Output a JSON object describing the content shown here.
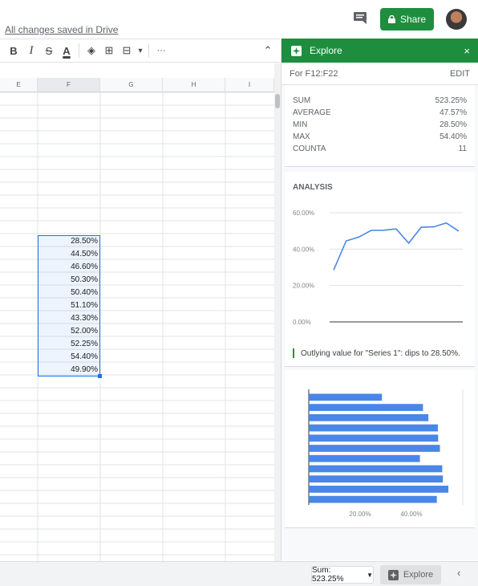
{
  "topbar": {
    "saved_text": "All changes saved in Drive",
    "share_label": "Share"
  },
  "toolbar": {
    "bold": "B",
    "italic": "I",
    "strike": "S",
    "text_color": "A",
    "fill": "◈",
    "borders": "⊞",
    "merge": "⊟",
    "dropdown": "▾",
    "more": "···",
    "collapse": "⌃"
  },
  "grid": {
    "columns": [
      "E",
      "F",
      "G",
      "H",
      "I"
    ],
    "selected_column": "F",
    "values": [
      "28.50%",
      "44.50%",
      "46.60%",
      "50.30%",
      "50.40%",
      "51.10%",
      "43.30%",
      "52.00%",
      "52.25%",
      "54.40%",
      "49.90%"
    ]
  },
  "explore": {
    "title": "Explore",
    "close": "×",
    "range_label": "For F12:F22",
    "edit": "EDIT",
    "stats": [
      {
        "name": "SUM",
        "value": "523.25%"
      },
      {
        "name": "AVERAGE",
        "value": "47.57%"
      },
      {
        "name": "MIN",
        "value": "28.50%"
      },
      {
        "name": "MAX",
        "value": "54.40%"
      },
      {
        "name": "COUNTA",
        "value": "11"
      }
    ],
    "analysis_title": "ANALYSIS",
    "insight": "Outlying value for \"Series 1\": dips to 28.50%."
  },
  "chart_data": [
    {
      "type": "line",
      "x": [
        1,
        2,
        3,
        4,
        5,
        6,
        7,
        8,
        9,
        10,
        11
      ],
      "series": [
        {
          "values": [
            28.5,
            44.5,
            46.6,
            50.3,
            50.4,
            51.1,
            43.3,
            52.0,
            52.25,
            54.4,
            49.9
          ]
        }
      ],
      "ylim": [
        0,
        60
      ],
      "y_ticks": [
        "60.00%",
        "40.00%",
        "20.00%",
        "0.00%"
      ],
      "grid": true,
      "color": "#4a86e8"
    },
    {
      "type": "bar",
      "orientation": "horizontal",
      "values": [
        28.5,
        44.5,
        46.6,
        50.3,
        50.4,
        51.1,
        43.3,
        52.0,
        52.25,
        54.4,
        49.9
      ],
      "xlim": [
        0,
        60
      ],
      "x_ticks": [
        "20.00%",
        "40.00%"
      ],
      "color": "#4a86e8"
    }
  ],
  "bottombar": {
    "sum_label": "Sum: 523.25%",
    "explore_label": "Explore",
    "collapse": "‹"
  }
}
